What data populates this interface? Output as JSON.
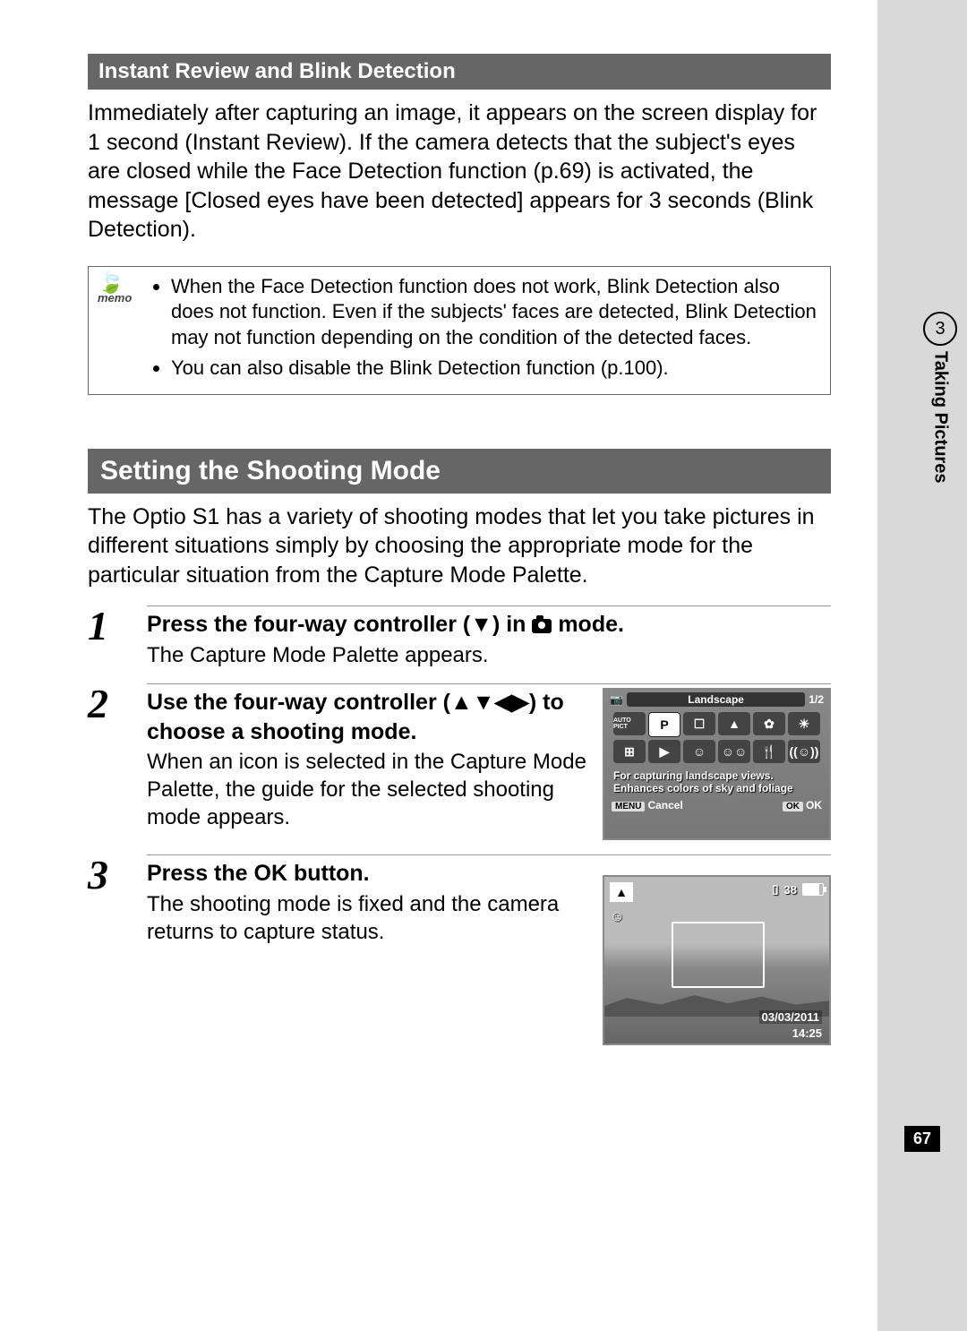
{
  "side_tab": {
    "chapter_num": "3",
    "chapter_title": "Taking Pictures"
  },
  "page_number": "67",
  "section_sub_title": "Instant Review and Blink Detection",
  "intro_paragraph": "Immediately after capturing an image, it appears on the screen display for 1 second (Instant Review). If the camera detects that the subject's eyes are closed while the Face Detection function (p.69) is activated, the message [Closed eyes have been detected] appears for 3 seconds (Blink Detection).",
  "memo_label": "memo",
  "memo_items": [
    "When the Face Detection function does not work, Blink Detection also does not function. Even if the subjects' faces are detected, Blink Detection may not function depending on the condition of the detected faces.",
    "You can also disable the Blink Detection function (p.100)."
  ],
  "section_main_title": "Setting the Shooting Mode",
  "main_paragraph": "The Optio S1 has a variety of shooting modes that let you take pictures in different situations simply by choosing the appropriate mode for the particular situation from the Capture Mode Palette.",
  "steps": [
    {
      "num": "1",
      "title_pre": "Press the four-way controller (▼) in ",
      "title_post": " mode.",
      "desc": "The Capture Mode Palette appears."
    },
    {
      "num": "2",
      "title": "Use the four-way controller (▲▼◀▶) to choose a shooting mode.",
      "desc": "When an icon is selected in the Capture Mode Palette, the guide for the selected shooting mode appears."
    },
    {
      "num": "3",
      "title": "Press the OK button.",
      "desc": "The shooting mode is fixed and the camera returns to capture status."
    }
  ],
  "lcd1": {
    "mode_name": "Landscape",
    "page": "1/2",
    "row1": [
      "AUTO PICT",
      "P",
      "☐",
      "▲",
      "✿",
      "☀"
    ],
    "row2": [
      "⊞",
      "▶",
      "☺",
      "☺☺",
      "🍴",
      "((☺))"
    ],
    "selected_index": 3,
    "description": "For capturing landscape views. Enhances colors of sky and foliage",
    "menu_label": "MENU",
    "cancel_label": "Cancel",
    "ok_box": "OK",
    "ok_label": "OK"
  },
  "lcd2": {
    "mode_glyph": "▲",
    "shots": "38",
    "date": "03/03/2011",
    "time": "14:25"
  }
}
